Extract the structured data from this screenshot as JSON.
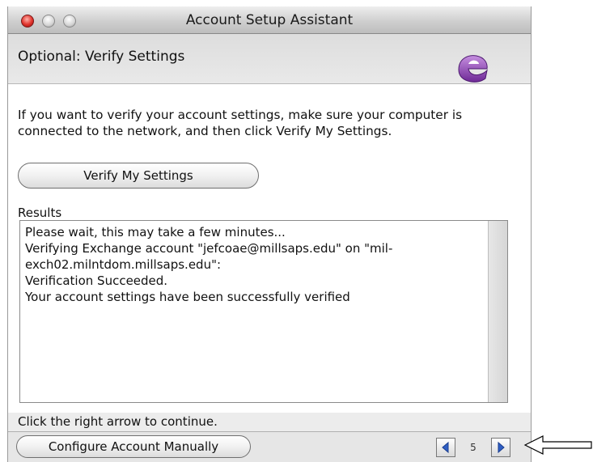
{
  "window": {
    "title": "Account Setup Assistant"
  },
  "header": {
    "step_title": "Optional: Verify Settings",
    "logo_icon": "entourage-e-icon"
  },
  "content": {
    "instructions": "If you want to verify your account settings, make sure your computer is connected to the network, and then click Verify My Settings.",
    "verify_button": "Verify My Settings",
    "results_label": "Results",
    "results_lines": [
      "Please wait, this may take a few minutes...",
      "",
      "Verifying Exchange account \"jefcoae@millsaps.edu\" on \"mil-exch02.milntdom.millsaps.edu\":",
      "Verification Succeeded.",
      "",
      "Your account settings have been successfully verified"
    ],
    "continue_hint": "Click the right arrow to continue."
  },
  "footer": {
    "configure_button": "Configure Account Manually",
    "page_number": "5",
    "prev_icon": "left-triangle-icon",
    "next_icon": "right-triangle-icon"
  },
  "colors": {
    "arrow_blue": "#2f5fc4",
    "logo_purple": "#8a3fb0",
    "close_red": "#e0322b"
  }
}
